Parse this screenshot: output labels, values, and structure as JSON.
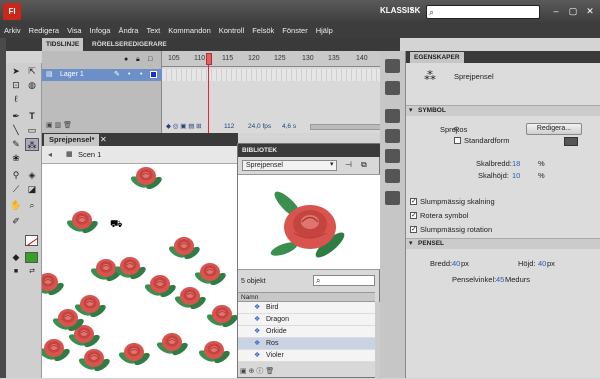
{
  "app": {
    "logo": "Fl",
    "workspace": "KLASSISK",
    "search_placeholder": ""
  },
  "window_buttons": [
    "–",
    "▢",
    "✕"
  ],
  "menu": [
    "Arkiv",
    "Redigera",
    "Visa",
    "Infoga",
    "Ändra",
    "Text",
    "Kommandon",
    "Kontroll",
    "Felsök",
    "Fönster",
    "Hjälp"
  ],
  "tabs": {
    "timeline": "TIDSLINJE",
    "motion_editor": "RÖRELSEREDIGERARE"
  },
  "timeline": {
    "frame_numbers": [
      "105",
      "110",
      "115",
      "120",
      "125",
      "130",
      "135",
      "140"
    ],
    "layer_name": "Lager 1",
    "current_frame": "112",
    "fps": "24,0 fps",
    "time": "4,6 s"
  },
  "document": {
    "tab": "Sprejpensel*",
    "scene": "Scen 1"
  },
  "library": {
    "title": "BIBLIOTEK",
    "dropdown": "Sprejpensel",
    "item_count": "5 objekt",
    "column_name": "Namn",
    "items": [
      "Bird",
      "Dragon",
      "Orkide",
      "Ros",
      "Violer"
    ],
    "selected_index": 3
  },
  "properties": {
    "tab": "EGENSKAPER",
    "tool_name": "Sprejpensel",
    "symbol_section": "SYMBOL",
    "spray_label": "Sprej:",
    "spray_value": "Ros",
    "edit_button": "Redigera...",
    "default_form": "Standardform",
    "scale_width_label": "Skalbredd:",
    "scale_width_value": "18",
    "scale_height_label": "Skalhöjd:",
    "scale_height_value": "10",
    "percent": "%",
    "random_scaling": "Slumpmässig skalning",
    "rotate_symbol": "Rotera symbol",
    "random_rotation": "Slumpmässig rotation",
    "brush_section": "PENSEL",
    "width_label": "Bredd:",
    "width_value": "40",
    "height_label": "Höjd:",
    "height_value": "40",
    "px": "px",
    "brush_angle_label": "Penselvinkel:",
    "brush_angle_value": "45",
    "clockwise": "Medurs"
  },
  "colors": {
    "accent": "#6c8fc7",
    "rose": "#d9534f",
    "leaf": "#3a8f4f",
    "fill_swatch": "#3a9c2a"
  }
}
